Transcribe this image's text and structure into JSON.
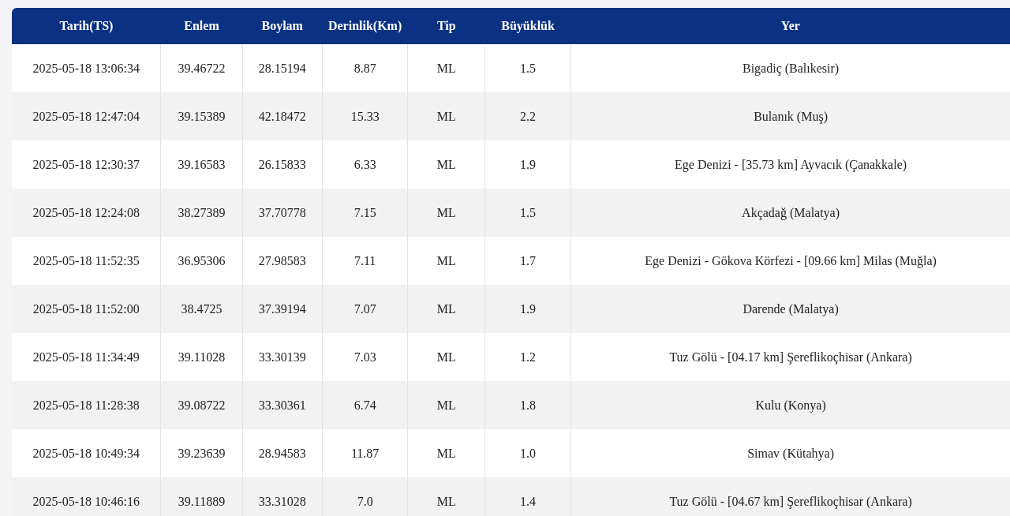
{
  "table": {
    "columns": [
      "Tarih(TS)",
      "Enlem",
      "Boylam",
      "Derinlik(Km)",
      "Tip",
      "Büyüklük",
      "Yer"
    ],
    "rows": [
      [
        "2025-05-18 13:06:34",
        "39.46722",
        "28.15194",
        "8.87",
        "ML",
        "1.5",
        "Bigadiç (Balıkesir)"
      ],
      [
        "2025-05-18 12:47:04",
        "39.15389",
        "42.18472",
        "15.33",
        "ML",
        "2.2",
        "Bulanık (Muş)"
      ],
      [
        "2025-05-18 12:30:37",
        "39.16583",
        "26.15833",
        "6.33",
        "ML",
        "1.9",
        "Ege Denizi - [35.73 km] Ayvacık (Çanakkale)"
      ],
      [
        "2025-05-18 12:24:08",
        "38.27389",
        "37.70778",
        "7.15",
        "ML",
        "1.5",
        "Akçadağ (Malatya)"
      ],
      [
        "2025-05-18 11:52:35",
        "36.95306",
        "27.98583",
        "7.11",
        "ML",
        "1.7",
        "Ege Denizi - Gökova Körfezi - [09.66 km] Milas (Muğla)"
      ],
      [
        "2025-05-18 11:52:00",
        "38.4725",
        "37.39194",
        "7.07",
        "ML",
        "1.9",
        "Darende (Malatya)"
      ],
      [
        "2025-05-18 11:34:49",
        "39.11028",
        "33.30139",
        "7.03",
        "ML",
        "1.2",
        "Tuz Gölü - [04.17 km] Şereflikoçhisar (Ankara)"
      ],
      [
        "2025-05-18 11:28:38",
        "39.08722",
        "33.30361",
        "6.74",
        "ML",
        "1.8",
        "Kulu (Konya)"
      ],
      [
        "2025-05-18 10:49:34",
        "39.23639",
        "28.94583",
        "11.87",
        "ML",
        "1.0",
        "Simav (Kütahya)"
      ],
      [
        "2025-05-18 10:46:16",
        "39.11889",
        "33.31028",
        "7.0",
        "ML",
        "1.4",
        "Tuz Gölü - [04.67 km] Şereflikoçhisar (Ankara)"
      ]
    ]
  }
}
